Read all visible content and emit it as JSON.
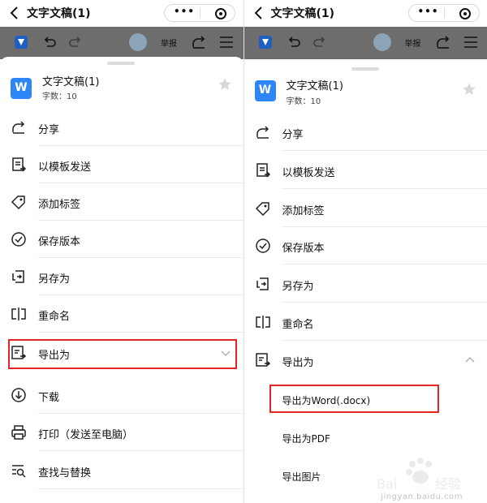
{
  "app": {
    "title": "文字文稿(1)"
  },
  "toolbar": {
    "report_label": "举报"
  },
  "document": {
    "icon_letter": "W",
    "name": "文字文稿(1)",
    "meta": "字数：10"
  },
  "menu": [
    {
      "label": "分享",
      "icon": "share-icon"
    },
    {
      "label": "以模板发送",
      "icon": "template-send-icon"
    },
    {
      "label": "添加标签",
      "icon": "tag-icon"
    },
    {
      "label": "保存版本",
      "icon": "check-circle-icon"
    },
    {
      "label": "另存为",
      "icon": "save-as-icon"
    },
    {
      "label": "重命名",
      "icon": "rename-icon"
    },
    {
      "label": "导出为",
      "icon": "export-icon"
    },
    {
      "label": "下载",
      "icon": "download-icon"
    },
    {
      "label": "打印（发送至电脑）",
      "icon": "print-icon"
    },
    {
      "label": "查找与替换",
      "icon": "find-replace-icon"
    }
  ],
  "export_submenu": [
    {
      "label": "导出为Word(.docx)"
    },
    {
      "label": "导出为PDF"
    },
    {
      "label": "导出图片"
    }
  ],
  "watermark": {
    "text": "jingyan.baidu.com"
  },
  "colors": {
    "highlight": "#e52525",
    "toolbar": "#6d6d6d",
    "doc_icon": "#2e86f6"
  }
}
